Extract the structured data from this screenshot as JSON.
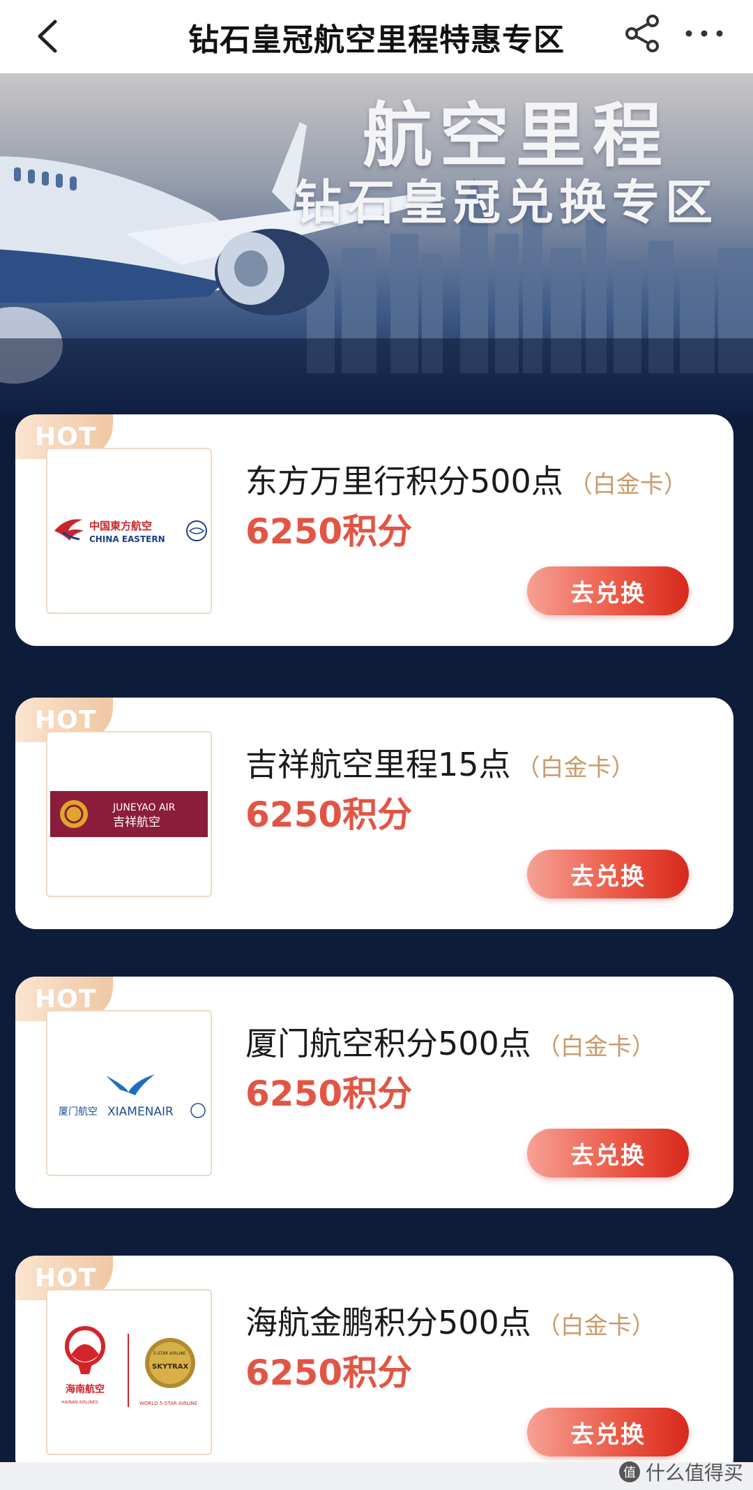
{
  "nav": {
    "title": "钻石皇冠航空里程特惠专区"
  },
  "banner": {
    "title": "航空里程",
    "subtitle": "钻石皇冠兑换专区"
  },
  "logos": {
    "china_eastern": {
      "cn": "中国東方航空",
      "en": "CHINA EASTERN"
    },
    "juneyao": {
      "en": "JUNEYAO AIR",
      "cn": "吉祥航空"
    },
    "xiamen": {
      "cn": "厦门航空",
      "en": "XIAMENAIR"
    },
    "hainan": {
      "cn": "海南航空",
      "en": "HAINAN AIRLINES",
      "skytrax": "SKYTRAX",
      "skytrax_top": "5-STAR AIRLINE",
      "skytrax_caption": "WORLD 5-STAR AIRLINE"
    }
  },
  "cards": [
    {
      "badge": "HOT",
      "title": "东方万里行积分500点",
      "tier": "（白金卡）",
      "price": "6250积分",
      "button": "去兑换"
    },
    {
      "badge": "HOT",
      "title": "吉祥航空里程15点",
      "tier": "（白金卡）",
      "price": "6250积分",
      "button": "去兑换"
    },
    {
      "badge": "HOT",
      "title": "厦门航空积分500点",
      "tier": "（白金卡）",
      "price": "6250积分",
      "button": "去兑换"
    },
    {
      "badge": "HOT",
      "title": "海航金鹏积分500点",
      "tier": "（白金卡）",
      "price": "6250积分",
      "button": "去兑换"
    }
  ],
  "watermark": {
    "text": "什么值得买",
    "icon_text": "值"
  },
  "colors": {
    "page_bg": "#0d1c38",
    "accent_red": "#e25545",
    "tier_gold": "#c99a6a",
    "hot_badge": "#efc7a3"
  }
}
